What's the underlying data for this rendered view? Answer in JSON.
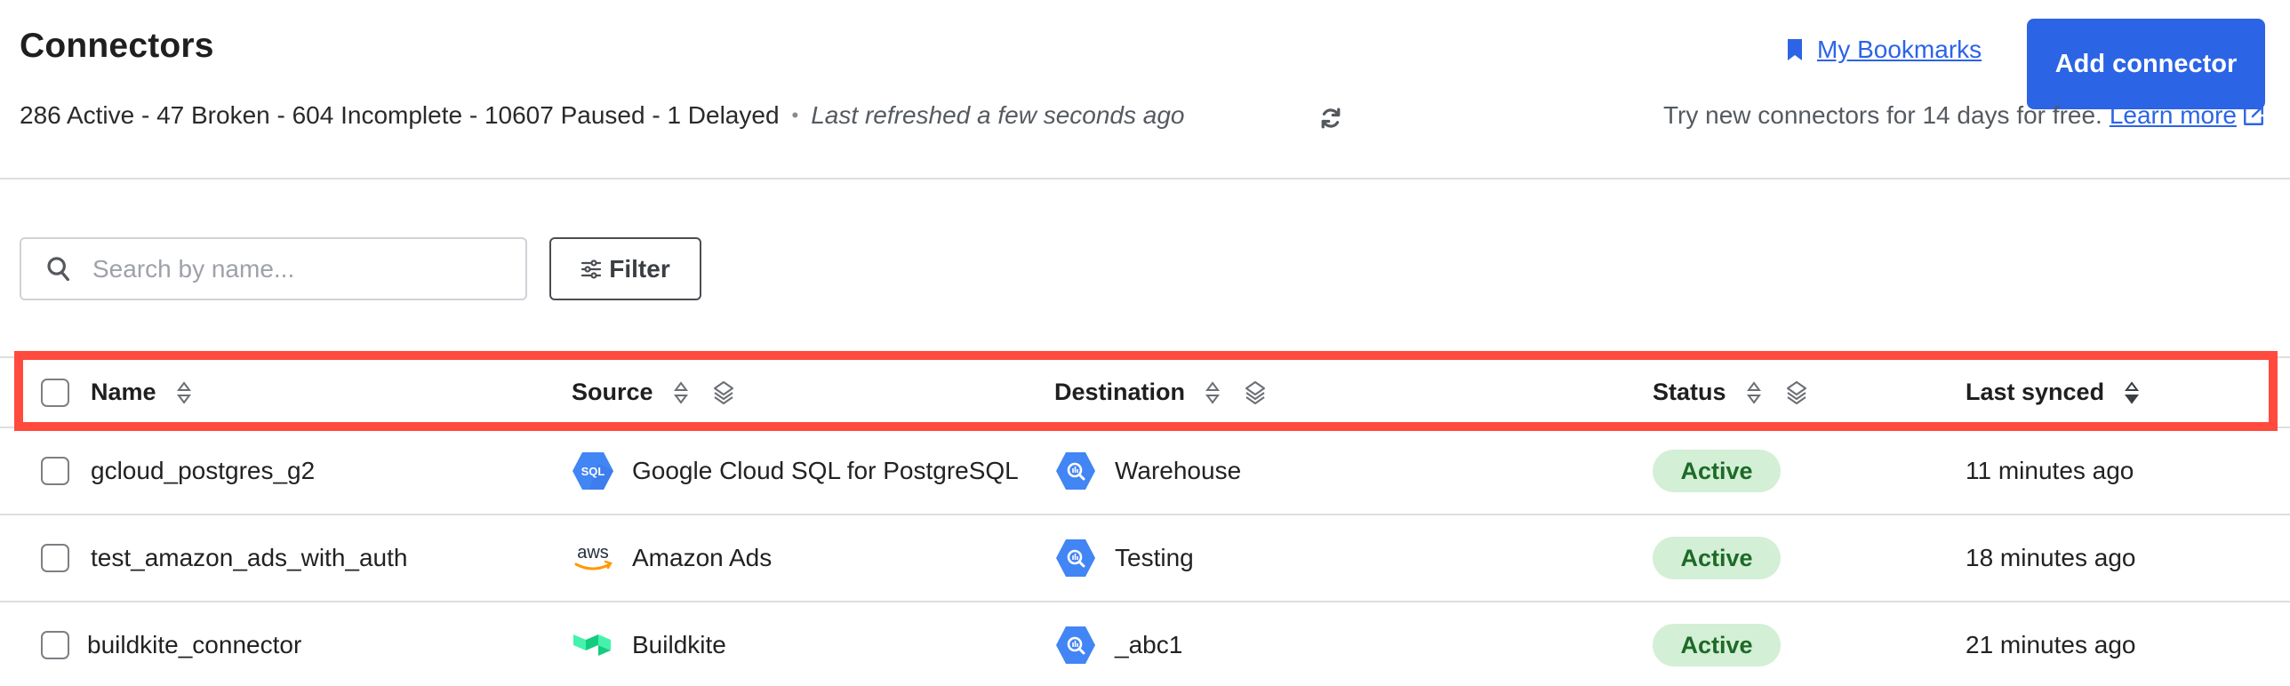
{
  "header": {
    "title": "Connectors",
    "stats": "286 Active - 47 Broken - 604 Incomplete - 10607 Paused - 1 Delayed",
    "separator": "•",
    "last_refreshed": "Last refreshed a few seconds ago",
    "refresh_icon": "refresh-icon",
    "bookmarks_label": "My Bookmarks",
    "bookmark_icon": "bookmark-icon",
    "add_button_label": "Add connector",
    "trial_text": "Try new connectors for 14 days for free.",
    "learn_more_label": "Learn more",
    "external_link_icon": "external-link-icon"
  },
  "toolbar": {
    "search_placeholder": "Search by name...",
    "search_value": "",
    "filter_label": "Filter"
  },
  "table": {
    "columns": [
      {
        "label": "Name",
        "sortable": true,
        "groupable": false
      },
      {
        "label": "Source",
        "sortable": true,
        "groupable": true
      },
      {
        "label": "Destination",
        "sortable": true,
        "groupable": true
      },
      {
        "label": "Status",
        "sortable": true,
        "groupable": true
      },
      {
        "label": "Last synced",
        "sortable": true,
        "groupable": false,
        "sort_direction": "descending"
      }
    ],
    "rows": [
      {
        "name": "gcloud_postgres_g2",
        "source": "Google Cloud SQL for PostgreSQL",
        "source_icon": "google-cloud-sql-icon",
        "destination": "Warehouse",
        "destination_icon": "bigquery-icon",
        "status": "Active",
        "last_synced": "11 minutes ago",
        "checked": false
      },
      {
        "name": "test_amazon_ads_with_auth",
        "source": "Amazon Ads",
        "source_icon": "aws-icon",
        "destination": "Testing",
        "destination_icon": "bigquery-icon",
        "status": "Active",
        "last_synced": "18 minutes ago",
        "checked": false
      },
      {
        "name": "buildkite_connector",
        "source": "Buildkite",
        "source_icon": "buildkite-icon",
        "destination": "_abc1",
        "destination_icon": "bigquery-icon",
        "status": "Active",
        "last_synced": "21 minutes ago",
        "checked": false
      }
    ]
  },
  "colors": {
    "accent": "#2c64e6",
    "status_active_bg": "#d3efd6",
    "status_active_text": "#1e6a27",
    "highlight": "#ff4a3d"
  }
}
